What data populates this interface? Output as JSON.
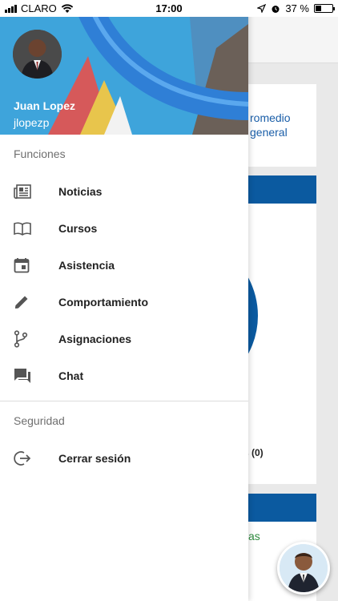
{
  "status_bar": {
    "carrier": "CLARO",
    "time": "17:00",
    "battery_text": "37 %",
    "battery_level": 0.37
  },
  "header": {
    "name": "Juan Lopez",
    "username": "jlopezp"
  },
  "sections": {
    "functions_title": "Funciones",
    "security_title": "Seguridad"
  },
  "menu": {
    "noticias": "Noticias",
    "cursos": "Cursos",
    "asistencia": "Asistencia",
    "comportamiento": "Comportamiento",
    "asignaciones": "Asignaciones",
    "chat": "Chat",
    "logout": "Cerrar sesión"
  },
  "background": {
    "card_title": "romedio general",
    "count": "s (0)",
    "green_text": "as"
  },
  "colors": {
    "accent_blue": "#0b5aa0",
    "header_blue": "#3aa0d8"
  }
}
